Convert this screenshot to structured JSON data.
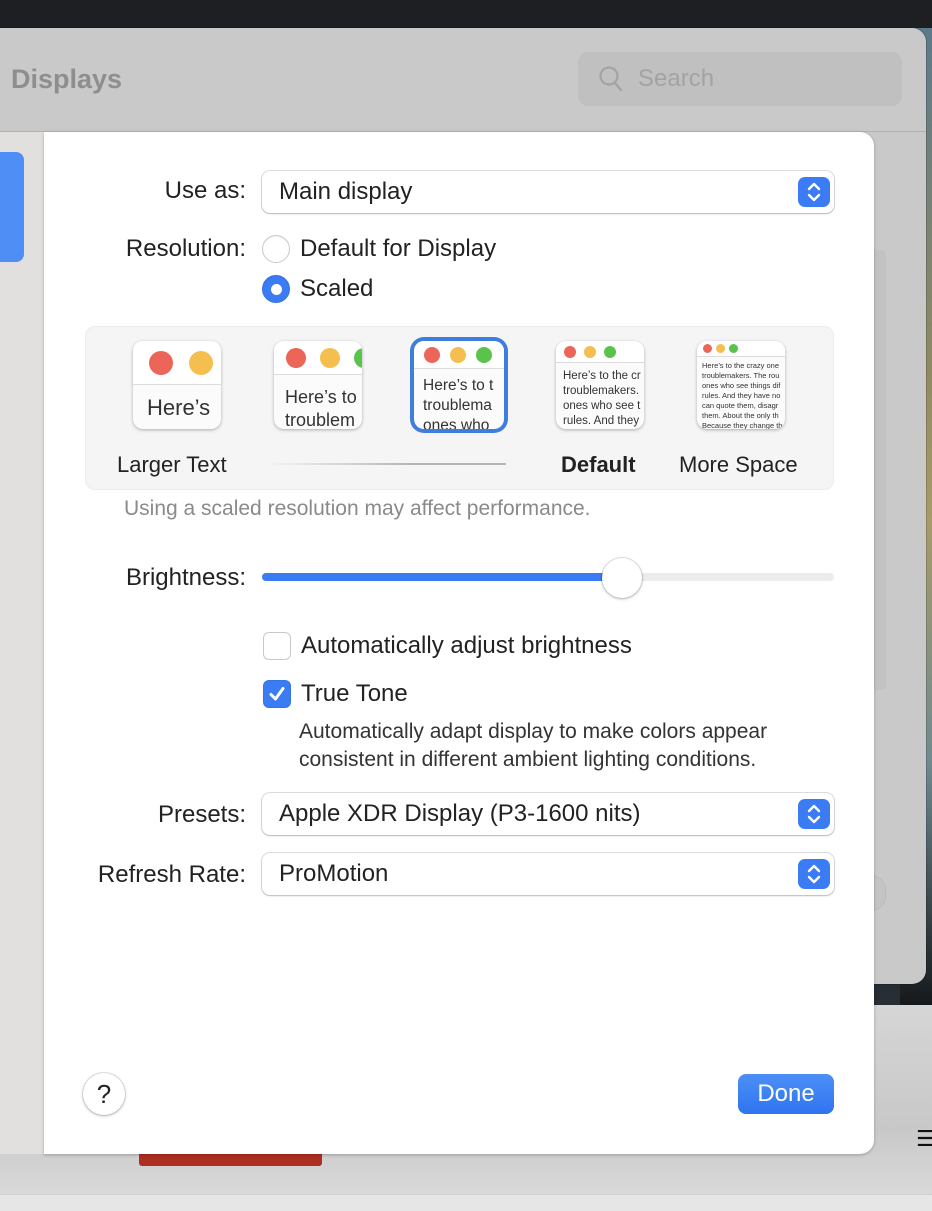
{
  "window": {
    "title": "Displays",
    "search_placeholder": "Search"
  },
  "sheet": {
    "use_as": {
      "label": "Use as:",
      "value": "Main display"
    },
    "resolution": {
      "label": "Resolution:",
      "options": [
        {
          "label": "Default for Display",
          "selected": false
        },
        {
          "label": "Scaled",
          "selected": true
        }
      ]
    },
    "scaled_options": [
      {
        "label": "Larger Text",
        "preview_text": "Here’s",
        "selected": false
      },
      {
        "label": "",
        "preview_text": "Here’s to\ntroublem",
        "selected": false
      },
      {
        "label": "",
        "preview_text": "Here’s to t\ntroublema\nones who",
        "selected": true
      },
      {
        "label": "Default",
        "preview_text": "Here’s to the cr\ntroublemakers.\nones who see t\nrules. And they",
        "selected": false
      },
      {
        "label": "More Space",
        "preview_text": "Here’s to the crazy one\ntroublemakers. The rou\nones who see things dif\nrules. And they have no\ncan quote them, disagr\nthem. About the only th\nBecause they change th",
        "selected": false
      }
    ],
    "scaled_note": "Using a scaled resolution may affect performance.",
    "brightness": {
      "label": "Brightness:",
      "value_percent": 63
    },
    "auto_brightness": {
      "label": "Automatically adjust brightness",
      "checked": false
    },
    "true_tone": {
      "label": "True Tone",
      "checked": true,
      "description_line1": "Automatically adapt display to make colors appear",
      "description_line2": "consistent in different ambient lighting conditions."
    },
    "presets": {
      "label": "Presets:",
      "value": "Apple XDR Display (P3-1600 nits)"
    },
    "refresh_rate": {
      "label": "Refresh Rate:",
      "value": "ProMotion"
    },
    "help_label": "?",
    "done_label": "Done"
  },
  "colors": {
    "accent": "#3b7cf5",
    "traffic_red": "#ec6559",
    "traffic_yellow": "#f4bf4f",
    "traffic_green": "#5ac34b"
  }
}
